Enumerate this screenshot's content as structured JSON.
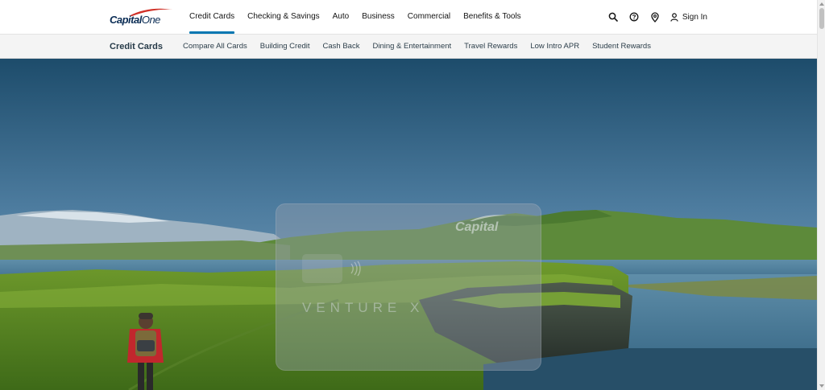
{
  "brand": {
    "logo_text_bold": "Capital",
    "logo_text_light": "One",
    "colors": {
      "navy": "#0b2d55",
      "red_swoosh": "#d03027",
      "active_underline": "#0276b1"
    }
  },
  "header": {
    "nav": [
      {
        "label": "Credit Cards",
        "active": true
      },
      {
        "label": "Checking & Savings",
        "active": false
      },
      {
        "label": "Auto",
        "active": false
      },
      {
        "label": "Business",
        "active": false
      },
      {
        "label": "Commercial",
        "active": false
      },
      {
        "label": "Benefits & Tools",
        "active": false
      }
    ],
    "utility": {
      "icons": [
        "search-icon",
        "help-icon",
        "location-pin-icon",
        "person-icon"
      ],
      "signin_label": "Sign In"
    }
  },
  "subnav": {
    "title": "Credit Cards",
    "items": [
      "Compare All Cards",
      "Building Credit",
      "Cash Back",
      "Dining & Entertainment",
      "Travel Rewards",
      "Low Intro APR",
      "Student Rewards"
    ]
  },
  "hero": {
    "scene": "hiker walking on green cliffs by a lake with mountains",
    "card": {
      "brand_text": "Capital",
      "product_text": "VENTURE X"
    }
  }
}
